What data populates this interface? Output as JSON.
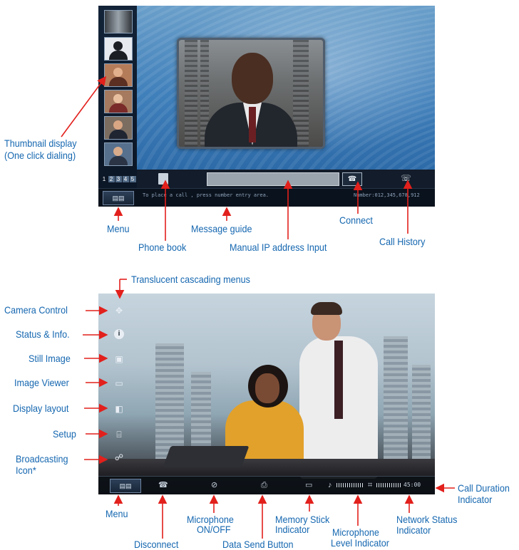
{
  "screen1": {
    "pager": [
      "1",
      "2",
      "3",
      "4",
      "5"
    ],
    "menu_label": "▤▤",
    "message_guide_text": "To place a call , press number entry area.",
    "number_text": "Number:012,345,678,912",
    "thumbnails": [
      "building",
      "silhouette",
      "woman1",
      "woman2",
      "man1",
      "man2"
    ]
  },
  "screen2": {
    "menu_label": "▤▤",
    "duration": "45:00"
  },
  "labels": {
    "thumbnail_display": "Thumbnail display",
    "thumbnail_display_sub": "(One click dialing)",
    "menu": "Menu",
    "phone_book": "Phone book",
    "message_guide": "Message guide",
    "manual_ip": "Manual IP address Input",
    "connect": "Connect",
    "call_history": "Call History",
    "translucent_menus": "Translucent cascading menus",
    "camera_control": "Camera Control",
    "status_info": "Status & Info.",
    "still_image": "Still Image",
    "image_viewer": "Image Viewer",
    "display_layout": "Display layout",
    "setup": "Setup",
    "broadcasting": "Broadcasting",
    "broadcasting_sub": "Icon*",
    "menu2": "Menu",
    "disconnect": "Disconnect",
    "microphone_onoff": "Microphone",
    "microphone_onoff_sub": "ON/OFF",
    "data_send": "Data Send Button",
    "memory_stick": "Memory Stick",
    "memory_stick_sub": "Indicator",
    "mic_level": "Microphone",
    "mic_level_sub": "Level Indicator",
    "network_status": "Network Status",
    "network_status_sub": "Indicator",
    "call_duration": "Call Duration",
    "call_duration_sub": "Indicator"
  },
  "colors": {
    "label": "#1567b0",
    "arrow": "#e2201c"
  }
}
